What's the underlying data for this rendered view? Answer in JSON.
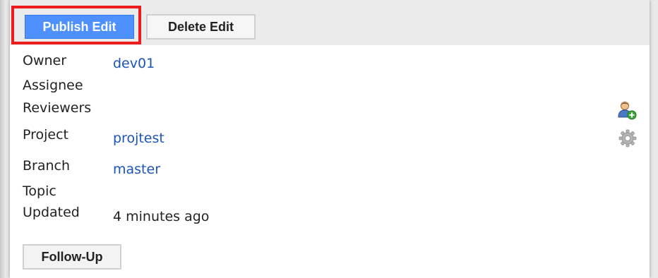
{
  "toolbar": {
    "publish_label": "Publish Edit",
    "delete_label": "Delete Edit"
  },
  "info": {
    "owner_label": "Owner",
    "owner_value": "dev01",
    "assignee_label": "Assignee",
    "reviewers_label": "Reviewers",
    "project_label": "Project",
    "project_value": "projtest",
    "branch_label": "Branch",
    "branch_value": "master",
    "topic_label": "Topic",
    "updated_label": "Updated",
    "updated_value": "4 minutes ago"
  },
  "actions": {
    "follow_up_label": "Follow-Up"
  },
  "icons": {
    "add_reviewer": "add-user-icon",
    "project_settings": "gear-icon"
  },
  "colors": {
    "publish_bg": "#4d90fe",
    "link": "#1a55b7",
    "highlight": "#ee1c1c"
  }
}
